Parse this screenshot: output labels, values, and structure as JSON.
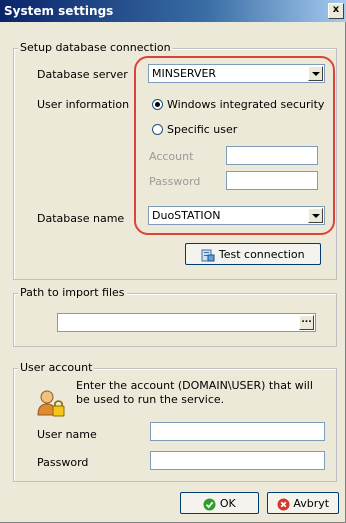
{
  "window": {
    "title": "System settings",
    "close_label": "x"
  },
  "db_group": {
    "legend": "Setup database connection",
    "server_label": "Database server",
    "server_value": "MINSERVER",
    "user_info_label": "User information",
    "radio_windows": "Windows integrated security",
    "radio_specific": "Specific user",
    "account_label": "Account",
    "password_label": "Password",
    "dbname_label": "Database name",
    "dbname_value": "DuoSTATION",
    "test_button": "Test connection"
  },
  "import_group": {
    "legend": "Path to import files",
    "path_value": "",
    "browse_label": "..."
  },
  "account_group": {
    "legend": "User account",
    "description": "Enter the account (DOMAIN\\USER) that will be used to run the service.",
    "username_label": "User name",
    "password_label": "Password"
  },
  "footer": {
    "ok_label": "OK",
    "cancel_label": "Avbryt"
  },
  "colors": {
    "highlight_ring": "#d9443a",
    "titlebar": "#0a246a",
    "ok_icon": "#2e9d2e",
    "cancel_icon": "#d23a2a"
  }
}
